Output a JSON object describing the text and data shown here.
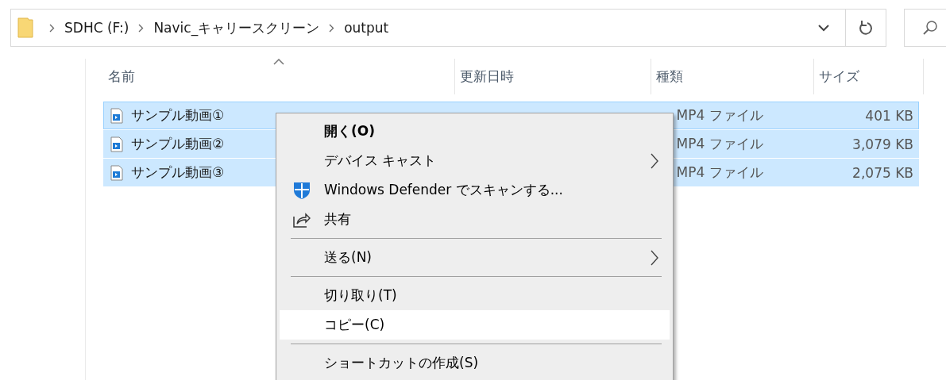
{
  "address_bar": {
    "path": [
      {
        "label": "SDHC (F:)"
      },
      {
        "label": "Navic_キャリースクリーン"
      },
      {
        "label": "output"
      }
    ]
  },
  "columns": [
    {
      "label": "名前",
      "sorted": true
    },
    {
      "label": "更新日時",
      "sorted": false
    },
    {
      "label": "種類",
      "sorted": false
    },
    {
      "label": "サイズ",
      "sorted": false
    }
  ],
  "files": [
    {
      "name": "サンプル動画①",
      "type": "MP4 ファイル",
      "size": "401 KB",
      "selected": true,
      "focused": true
    },
    {
      "name": "サンプル動画②",
      "type": "MP4 ファイル",
      "size": "3,079 KB",
      "selected": true,
      "focused": false
    },
    {
      "name": "サンプル動画③",
      "type": "MP4 ファイル",
      "size": "2,075 KB",
      "selected": true,
      "focused": false
    }
  ],
  "context_menu": {
    "items": [
      {
        "kind": "plain",
        "label": "開く(O)",
        "default": true,
        "submenu": false,
        "highlighted": false
      },
      {
        "kind": "plain",
        "label": "デバイス キャスト",
        "default": false,
        "submenu": true,
        "highlighted": false
      },
      {
        "kind": "scan",
        "label": "Windows Defender でスキャンする...",
        "default": false,
        "submenu": false,
        "highlighted": false
      },
      {
        "kind": "share",
        "label": "共有",
        "default": false,
        "submenu": false,
        "highlighted": false
      },
      {
        "kind": "separator"
      },
      {
        "kind": "plain",
        "label": "送る(N)",
        "default": false,
        "submenu": true,
        "highlighted": false
      },
      {
        "kind": "separator"
      },
      {
        "kind": "plain",
        "label": "切り取り(T)",
        "default": false,
        "submenu": false,
        "highlighted": false
      },
      {
        "kind": "plain",
        "label": "コピー(C)",
        "default": false,
        "submenu": false,
        "highlighted": true
      },
      {
        "kind": "separator"
      },
      {
        "kind": "plain",
        "label": "ショートカットの作成(S)",
        "default": false,
        "submenu": false,
        "highlighted": false
      }
    ]
  }
}
